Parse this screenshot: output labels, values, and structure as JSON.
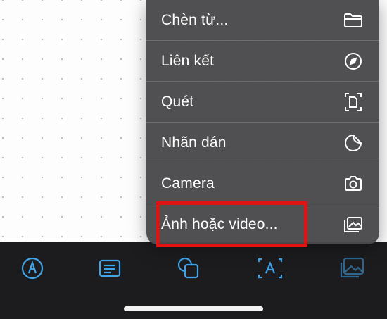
{
  "menu": {
    "items": [
      {
        "label": "Chèn từ...",
        "icon": "folder-icon"
      },
      {
        "label": "Liên kết",
        "icon": "compass-icon"
      },
      {
        "label": "Quét",
        "icon": "scan-document-icon"
      },
      {
        "label": "Nhãn dán",
        "icon": "sticker-icon"
      },
      {
        "label": "Camera",
        "icon": "camera-icon"
      },
      {
        "label": "Ảnh hoặc video...",
        "icon": "photo-library-icon"
      }
    ]
  },
  "toolbar": {
    "items": [
      {
        "icon": "pen-markup-icon"
      },
      {
        "icon": "text-box-icon"
      },
      {
        "icon": "shapes-icon"
      },
      {
        "icon": "text-field-icon"
      },
      {
        "icon": "photo-library-icon"
      }
    ]
  },
  "colors": {
    "menu_background": "#4a4a4c",
    "toolbar_background": "#1c1c1e",
    "toolbar_icon": "#3fa4e8",
    "highlight": "#e01313"
  }
}
